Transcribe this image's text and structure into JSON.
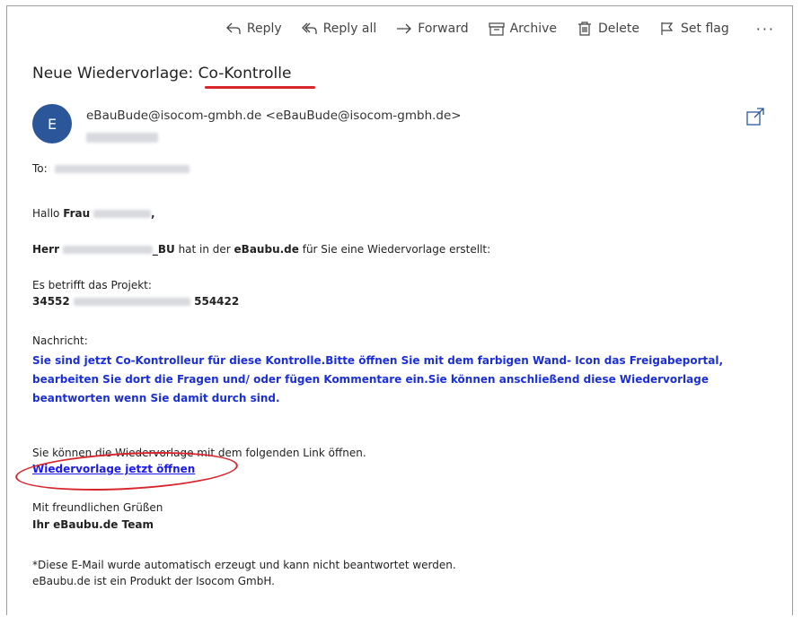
{
  "toolbar": {
    "reply": "Reply",
    "reply_all": "Reply all",
    "forward": "Forward",
    "archive": "Archive",
    "delete": "Delete",
    "set_flag": "Set flag",
    "more": "···"
  },
  "mail": {
    "subject_prefix": "Neue Wiedervorlage: ",
    "subject_highlight": "Co-Kontrolle",
    "avatar_initial": "E",
    "sender": "eBauBude@isocom-gmbh.de <eBauBude@isocom-gmbh.de>",
    "to_label": "To:",
    "greeting_prefix": "Hallo ",
    "greeting_bold": "Frau",
    "greeting_suffix": ",",
    "herr_bold": "Herr",
    "herr_name_suffix": "_BU",
    "herr_text": " hat in der ",
    "herr_site": "eBaubu.de",
    "herr_text2": " für Sie eine Wiedervorlage erstellt:",
    "project_label": "Es betrifft das Projekt:",
    "project_number": "34552",
    "project_code": "554422",
    "message_label": "Nachricht:",
    "message": "Sie sind jetzt Co-Kontrolleur für diese Kontrolle.Bitte öffnen Sie mit dem farbigen Wand- Icon das Freigabeportal, bearbeiten Sie dort die Fragen und/ oder fügen Kommentare ein.Sie können anschließend diese Wiedervorlage beantworten wenn Sie damit durch sind.",
    "link_intro": "Sie können die Wiedervorlage mit dem folgenden Link öffnen.",
    "link_text": "Wiedervorlage jetzt öffnen",
    "closing": "Mit freundlichen Grüßen",
    "team": "Ihr eBaubu.de Team",
    "auto_note": "*Diese E-Mail wurde automatisch erzeugt und kann nicht beantwortet werden.",
    "product_note": "eBaubu.de ist ein Produkt der Isocom GmbH."
  },
  "icons": [
    "reply-icon",
    "reply-all-icon",
    "forward-icon",
    "archive-icon",
    "delete-icon",
    "flag-icon",
    "more-icon",
    "popout-icon"
  ],
  "colors": {
    "accent_red": "#d8262c",
    "avatar_blue": "#2b579a",
    "message_blue": "#1a2fd8",
    "link_blue": "#1a1aee"
  }
}
